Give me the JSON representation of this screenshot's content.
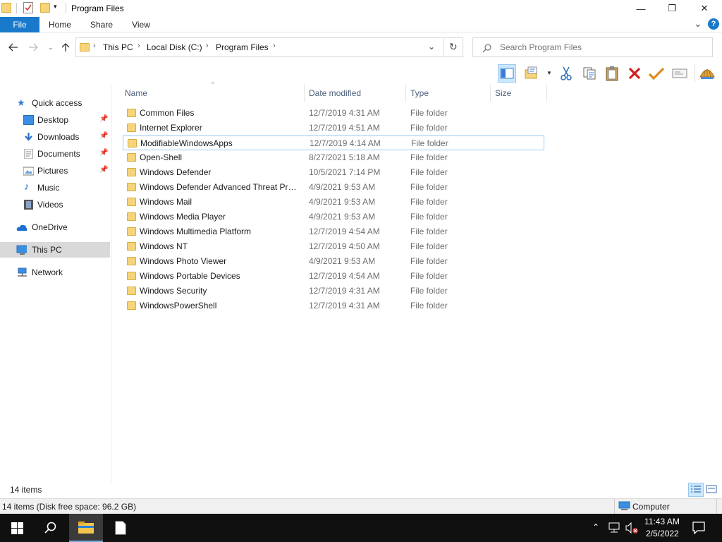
{
  "window": {
    "title": "Program Files",
    "minimize": "—",
    "maximize": "❐",
    "close": "✕"
  },
  "ribbon": {
    "tabs": [
      "File",
      "Home",
      "Share",
      "View"
    ],
    "collapse": "⌄",
    "help": "?"
  },
  "address": {
    "crumbs": [
      "This PC",
      "Local Disk (C:)",
      "Program Files"
    ],
    "refresh": "↻"
  },
  "search": {
    "placeholder": "Search Program Files"
  },
  "nav_pane": {
    "items": [
      {
        "label": "Quick access",
        "icon": "star-icon"
      },
      {
        "label": "Desktop",
        "icon": "desktop-icon",
        "pinned": true
      },
      {
        "label": "Downloads",
        "icon": "download-icon",
        "pinned": true
      },
      {
        "label": "Documents",
        "icon": "document-icon",
        "pinned": true
      },
      {
        "label": "Pictures",
        "icon": "pictures-icon",
        "pinned": true
      },
      {
        "label": "Music",
        "icon": "music-icon"
      },
      {
        "label": "Videos",
        "icon": "video-icon"
      },
      {
        "label": "OneDrive",
        "icon": "cloud-icon"
      },
      {
        "label": "This PC",
        "icon": "computer-icon",
        "selected": true
      },
      {
        "label": "Network",
        "icon": "network-icon"
      }
    ]
  },
  "columns": {
    "name": "Name",
    "date": "Date modified",
    "type": "Type",
    "size": "Size"
  },
  "files": [
    {
      "name": "Common Files",
      "date": "12/7/2019 4:31 AM",
      "type": "File folder"
    },
    {
      "name": "Internet Explorer",
      "date": "12/7/2019 4:51 AM",
      "type": "File folder"
    },
    {
      "name": "ModifiableWindowsApps",
      "date": "12/7/2019 4:14 AM",
      "type": "File folder",
      "focused": true
    },
    {
      "name": "Open-Shell",
      "date": "8/27/2021 5:18 AM",
      "type": "File folder"
    },
    {
      "name": "Windows Defender",
      "date": "10/5/2021 7:14 PM",
      "type": "File folder"
    },
    {
      "name": "Windows Defender Advanced Threat Prot...",
      "date": "4/9/2021 9:53 AM",
      "type": "File folder"
    },
    {
      "name": "Windows Mail",
      "date": "4/9/2021 9:53 AM",
      "type": "File folder"
    },
    {
      "name": "Windows Media Player",
      "date": "4/9/2021 9:53 AM",
      "type": "File folder"
    },
    {
      "name": "Windows Multimedia Platform",
      "date": "12/7/2019 4:54 AM",
      "type": "File folder"
    },
    {
      "name": "Windows NT",
      "date": "12/7/2019 4:50 AM",
      "type": "File folder"
    },
    {
      "name": "Windows Photo Viewer",
      "date": "4/9/2021 9:53 AM",
      "type": "File folder"
    },
    {
      "name": "Windows Portable Devices",
      "date": "12/7/2019 4:54 AM",
      "type": "File folder"
    },
    {
      "name": "Windows Security",
      "date": "12/7/2019 4:31 AM",
      "type": "File folder"
    },
    {
      "name": "WindowsPowerShell",
      "date": "12/7/2019 4:31 AM",
      "type": "File folder"
    }
  ],
  "status": {
    "item_count": "14 items",
    "details": "14 items (Disk free space: 96.2 GB)",
    "location": "Computer"
  },
  "taskbar": {
    "time": "11:43 AM",
    "date": "2/5/2022"
  },
  "colors": {
    "accent": "#1979ca",
    "folder": "#f6d47a",
    "selection": "#cce8ff",
    "taskbar": "#101010"
  }
}
